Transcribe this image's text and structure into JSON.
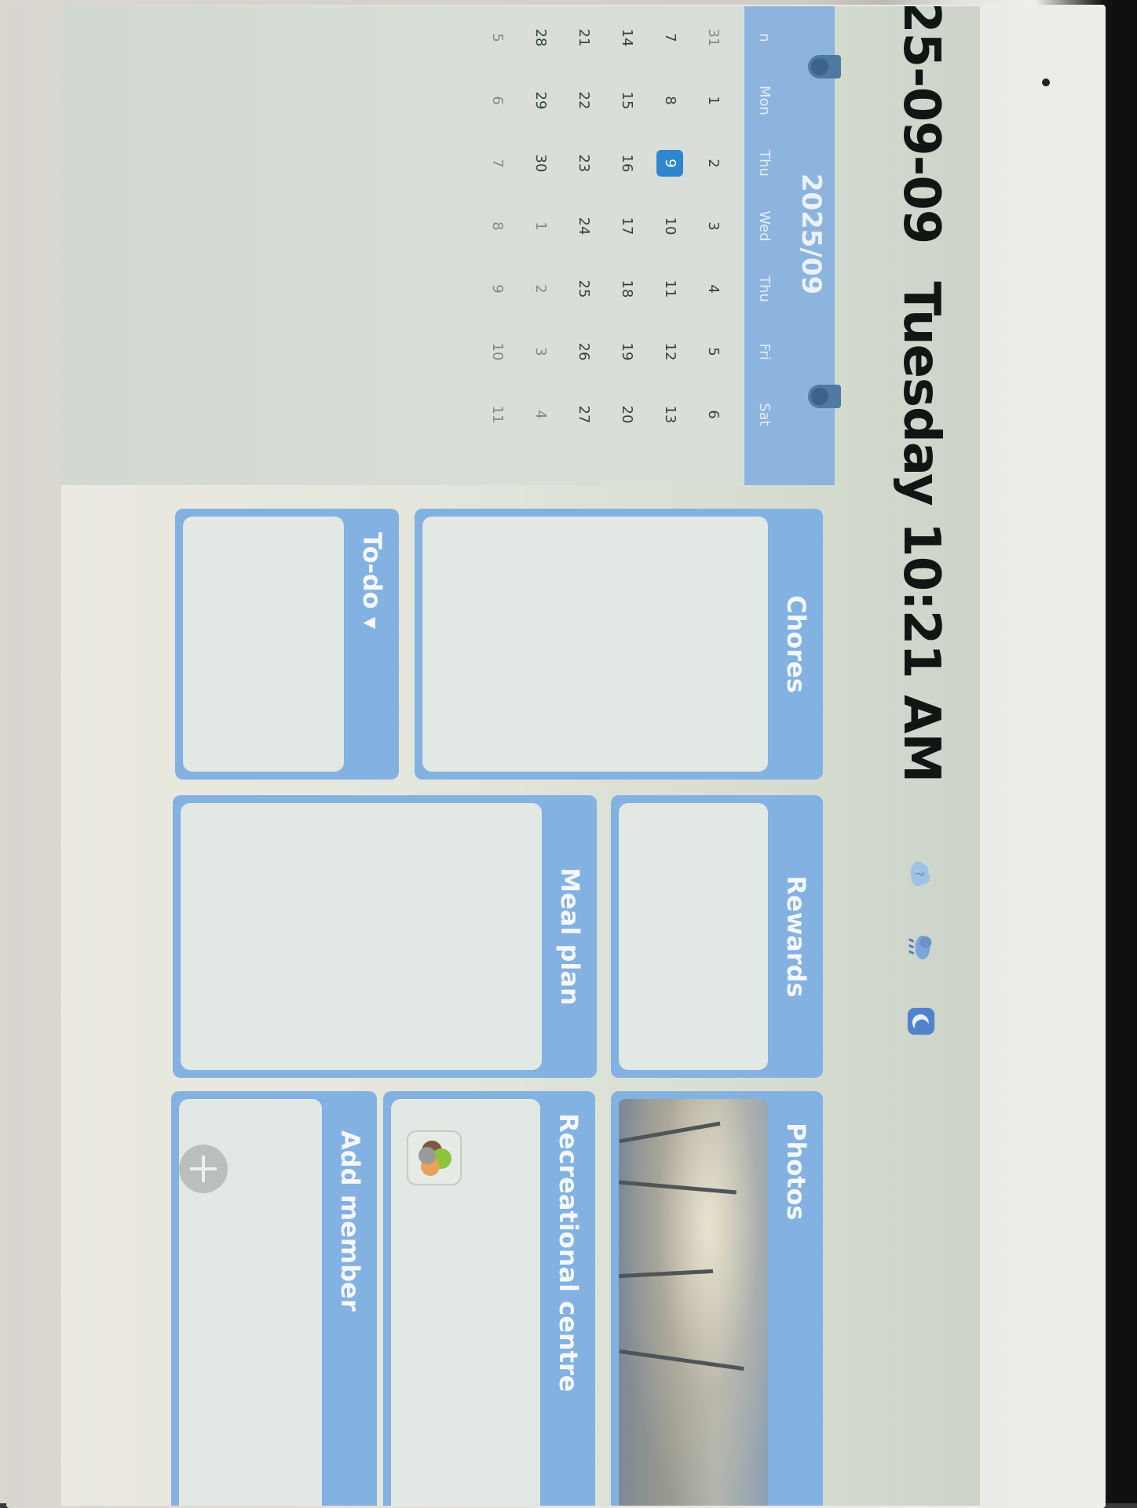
{
  "header": {
    "date": "25-09-09",
    "day_time": "Tuesday 10:21 AM",
    "weather_icons": [
      "cloud-question-icon",
      "cloud-rain-icon",
      "moon-icon"
    ]
  },
  "calendar": {
    "title": "2025/09",
    "weekdays": [
      "n",
      "Mon",
      "Thu",
      "Wed",
      "Thu",
      "Fri",
      "Sat"
    ],
    "weeks": [
      [
        "31",
        "1",
        "2",
        "3",
        "4",
        "5",
        "6"
      ],
      [
        "7",
        "8",
        "9",
        "10",
        "11",
        "12",
        "13"
      ],
      [
        "14",
        "15",
        "16",
        "17",
        "18",
        "19",
        "20"
      ],
      [
        "21",
        "22",
        "23",
        "24",
        "25",
        "26",
        "27"
      ],
      [
        "28",
        "29",
        "30",
        "1",
        "2",
        "3",
        "4"
      ],
      [
        "5",
        "6",
        "7",
        "8",
        "9",
        "10",
        "11"
      ]
    ],
    "today": "9"
  },
  "widgets": {
    "chores": {
      "title": "Chores"
    },
    "todo": {
      "title": "To-do"
    },
    "rewards": {
      "title": "Rewards"
    },
    "meal_plan": {
      "title": "Meal plan"
    },
    "photos": {
      "title": "Photos"
    },
    "recreational": {
      "title": "Recreational centre"
    },
    "add_member": {
      "title": "Add member"
    }
  },
  "colors": {
    "widget_header": "#82b1e2",
    "widget_body": "#e2e8e3",
    "today_highlight": "#2f86cf"
  }
}
